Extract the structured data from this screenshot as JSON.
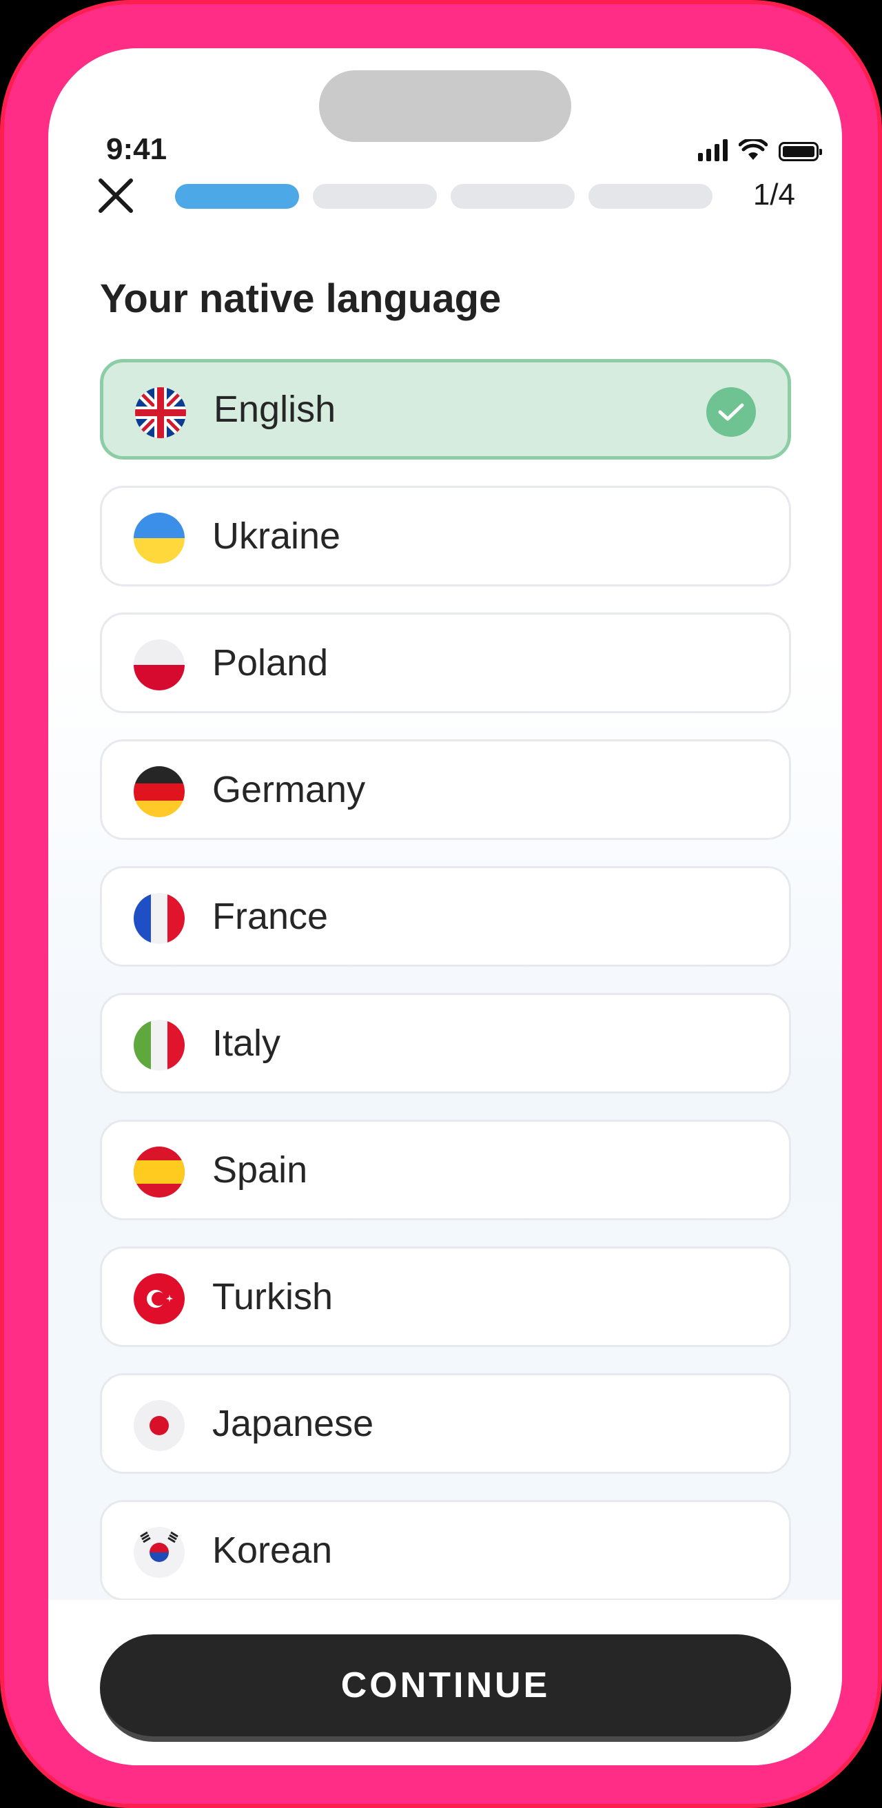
{
  "status_bar": {
    "time": "9:41"
  },
  "header": {
    "close_icon": "close-icon",
    "step_count": "1/4",
    "progress": {
      "current_step": 1,
      "total_steps": 4
    }
  },
  "title": "Your native language",
  "languages": [
    {
      "label": "English",
      "flag": "uk-flag-icon",
      "selected": true
    },
    {
      "label": "Ukraine",
      "flag": "ukraine-flag-icon",
      "selected": false
    },
    {
      "label": "Poland",
      "flag": "poland-flag-icon",
      "selected": false
    },
    {
      "label": "Germany",
      "flag": "germany-flag-icon",
      "selected": false
    },
    {
      "label": "France",
      "flag": "france-flag-icon",
      "selected": false
    },
    {
      "label": "Italy",
      "flag": "italy-flag-icon",
      "selected": false
    },
    {
      "label": "Spain",
      "flag": "spain-flag-icon",
      "selected": false
    },
    {
      "label": "Turkish",
      "flag": "turkey-flag-icon",
      "selected": false
    },
    {
      "label": "Japanese",
      "flag": "japan-flag-icon",
      "selected": false
    },
    {
      "label": "Korean",
      "flag": "korea-flag-icon",
      "selected": false
    }
  ],
  "continue_label": "CONTINUE",
  "colors": {
    "frame": "#FF2D86",
    "progress_active": "#4CA8E6",
    "selected_bg": "#D6ECDF",
    "selected_border": "#8CCDA5",
    "check": "#6FC393",
    "button": "#262626"
  }
}
